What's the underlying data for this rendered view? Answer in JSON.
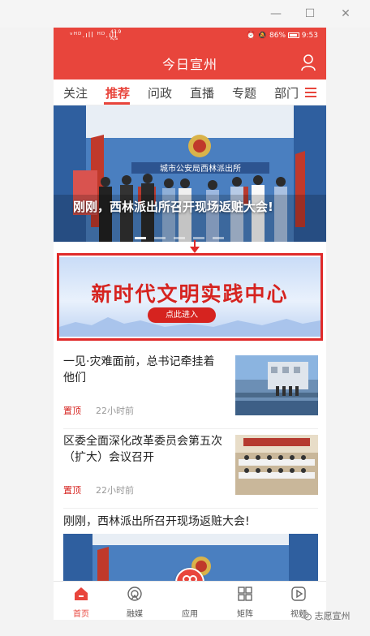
{
  "status_bar": {
    "signal": "ᵛᴴᴰ.ıll ᴴᴰ.ıll",
    "speed_value": "43.9",
    "speed_unit": "K/s",
    "battery": "86%",
    "time": "9:53"
  },
  "header": {
    "title": "今日宣州"
  },
  "tabs": [
    {
      "label": "关注"
    },
    {
      "label": "推荐"
    },
    {
      "label": "问政"
    },
    {
      "label": "直播"
    },
    {
      "label": "专题"
    },
    {
      "label": "部门"
    }
  ],
  "hero": {
    "caption": "刚刚，西林派出所召开现场返赃大会!",
    "sign_text": "城市公安局西林派出所"
  },
  "banner": {
    "title": "新时代文明实践中心",
    "button": "点此进入"
  },
  "news": [
    {
      "title": "一见·灾难面前，总书记牵挂着他们",
      "tag": "置顶",
      "time": "22小时前"
    },
    {
      "title": "区委全面深化改革委员会第五次（扩大）会议召开",
      "tag": "置顶",
      "time": "22小时前"
    }
  ],
  "big_news": {
    "title": "刚刚，西林派出所召开现场返赃大会!"
  },
  "bottom_nav": [
    {
      "label": "首页"
    },
    {
      "label": "融媒"
    },
    {
      "label": "应用"
    },
    {
      "label": "矩阵"
    },
    {
      "label": "视频"
    }
  ],
  "watermark": "志愿宣州",
  "colors": {
    "brand_red": "#e8453c",
    "banner_red": "#d6231f"
  }
}
